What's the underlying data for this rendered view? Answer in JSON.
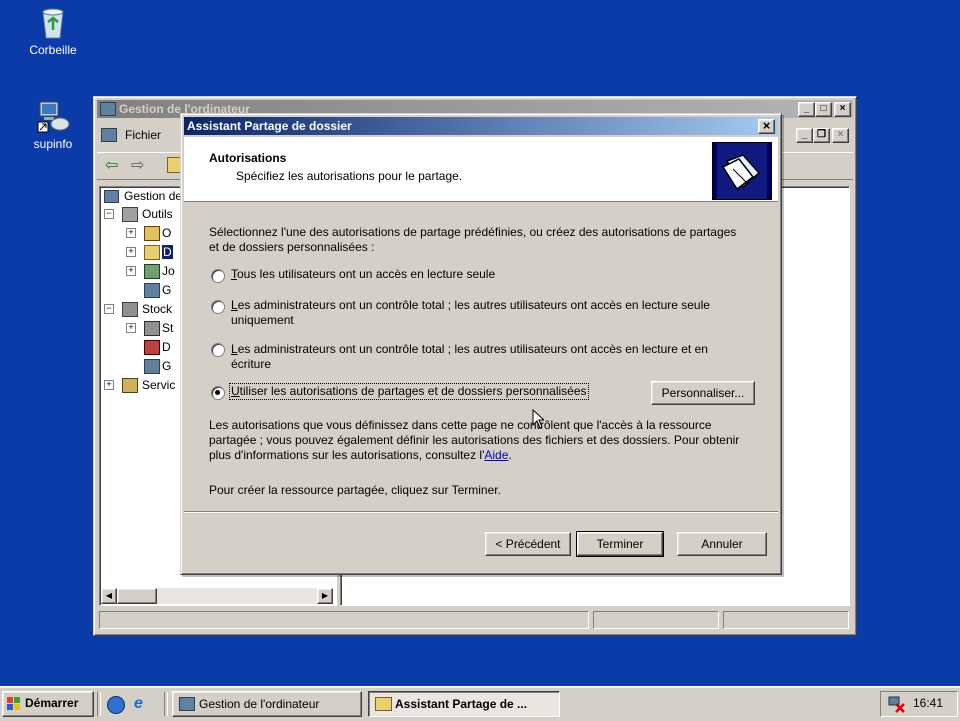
{
  "desktop": {
    "icons": [
      {
        "label": "Corbeille",
        "icon": "recycle-bin-icon"
      },
      {
        "label": "supinfo",
        "icon": "network-computer-icon"
      }
    ]
  },
  "background_window": {
    "title": "Gestion de l'ordinateur",
    "menu": {
      "file": "Fichier"
    },
    "tree": [
      "Gestion de",
      "Outils",
      "O",
      "D",
      "Jo",
      "G",
      "Stock",
      "St",
      "D",
      "G",
      "Servic"
    ]
  },
  "dialog": {
    "title": "Assistant Partage de dossier",
    "close": "×",
    "header": {
      "title": "Autorisations",
      "subtitle": "Spécifiez les autorisations pour le partage."
    },
    "intro": "Sélectionnez l'une des autorisations de partage prédéfinies, ou créez des autorisations de partages et de dossiers personnalisées :",
    "options": [
      {
        "label_key": "T",
        "label_rest": "ous les utilisateurs ont un accès en lecture seule",
        "selected": false
      },
      {
        "label_key": "L",
        "label_rest": "es administrateurs ont un contrôle total ; les autres utilisateurs ont accès en lecture seule uniquement",
        "selected": false
      },
      {
        "label_key": "L",
        "label_rest": "es administrateurs ont un contrôle total ; les autres utilisateurs ont accès en lecture et en écriture",
        "selected": false
      },
      {
        "label_key": "U",
        "label_rest": "tiliser les autorisations de partages et de dossiers personnalisées",
        "selected": true
      }
    ],
    "customize_button": "Personnaliser...",
    "info_text": "Les autorisations que vous définissez dans cette page ne contrôlent que l'accès à la ressource partagée ; vous pouvez également définir les autorisations des fichiers et des dossiers. Pour obtenir plus d'informations sur les autorisations, consultez l'",
    "info_link": "Aide",
    "info_end": ".",
    "finish_text": "Pour créer la ressource partagée, cliquez sur Terminer.",
    "buttons": {
      "back": "< Précédent",
      "finish": "Terminer",
      "cancel": "Annuler"
    }
  },
  "taskbar": {
    "start": "Démarrer",
    "items": [
      {
        "label": "Gestion de l'ordinateur",
        "active": false
      },
      {
        "label": "Assistant Partage de ...",
        "active": true
      }
    ],
    "clock": "16:41"
  },
  "colors": {
    "desktop": "#0a3ba8",
    "active_title": "#0a246a",
    "inactive_title": "#808080"
  }
}
